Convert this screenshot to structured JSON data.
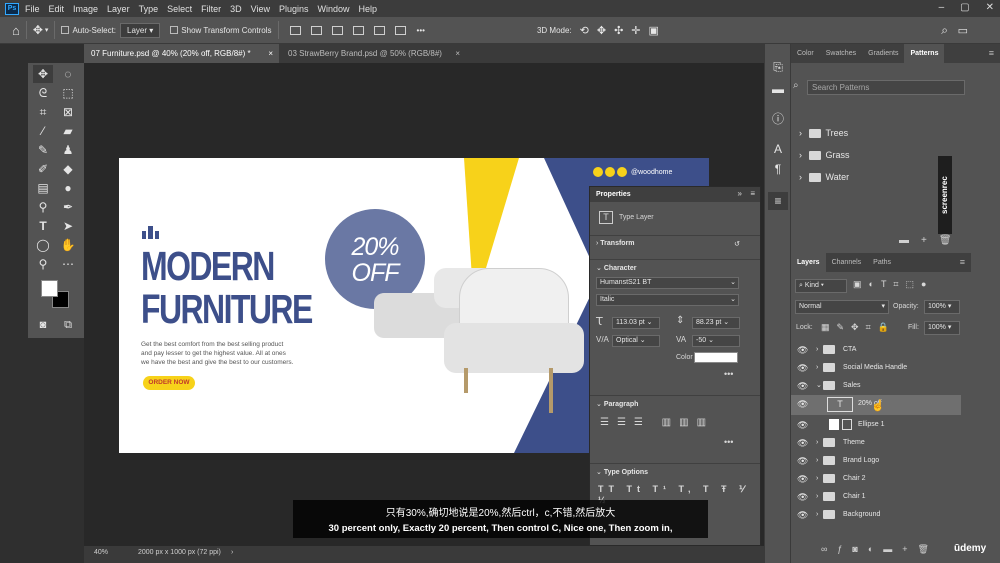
{
  "menu": {
    "items": [
      "File",
      "Edit",
      "Image",
      "Layer",
      "Type",
      "Select",
      "Filter",
      "3D",
      "View",
      "Plugins",
      "Window",
      "Help"
    ],
    "logo": "Ps",
    "window_controls": [
      "–",
      "▢",
      "✕"
    ]
  },
  "options": {
    "auto_select": "Auto-Select:",
    "layer_dropdown": "Layer",
    "show_transform": "Show Transform Controls",
    "mode_3d": "3D Mode:",
    "more": "•••"
  },
  "tabs": [
    {
      "label": "07 Furniture.psd @ 40% (20% off, RGB/8#) *",
      "close": "×",
      "active": true
    },
    {
      "label": "03 StrawBerry Brand.psd @ 50% (RGB/8#)",
      "close": "×",
      "active": false
    }
  ],
  "document": {
    "headline1": "MODERN",
    "headline2": "FURNITURE",
    "body": [
      "Get the best comfort from the best selling product",
      "and pay lesser to get the highest value. All at ones",
      "we have the best and give the best to our customers."
    ],
    "cta": "ORDER NOW",
    "badge_line1": "20%",
    "badge_line2": "OFF",
    "social_handle": "@woodhome",
    "colors": {
      "navy": "#3d4f8a",
      "yellow": "#f7d21a",
      "badge": "#6a78a4"
    }
  },
  "status": {
    "zoom": "40%",
    "doc_size": "2000 px x 1000 px (72 ppi)"
  },
  "properties": {
    "title": "Properties",
    "type_layer": "Type Layer",
    "transform": "Transform",
    "character": "Character",
    "font": "HumanstS21 BT",
    "style": "Italic",
    "size": "113.03 pt",
    "leading": "88.23 pt",
    "kerning": "Optical",
    "tracking": "-50",
    "color_label": "Color",
    "paragraph": "Paragraph",
    "type_options": "Type Options",
    "more": "•••"
  },
  "patterns_panel": {
    "tabs": [
      "Color",
      "Swatches",
      "Gradients",
      "Patterns"
    ],
    "search_placeholder": "Search Patterns",
    "groups": [
      "Trees",
      "Grass",
      "Water"
    ]
  },
  "layers_panel": {
    "tabs": [
      "Layers",
      "Channels",
      "Paths"
    ],
    "kind": "Kind",
    "blend": "Normal",
    "opacity_label": "Opacity:",
    "opacity": "100%",
    "lock_label": "Lock:",
    "fill_label": "Fill:",
    "fill": "100%",
    "layers": [
      {
        "name": "CTA",
        "type": "folder",
        "expanded": false
      },
      {
        "name": "Social Media Handle",
        "type": "folder",
        "expanded": false
      },
      {
        "name": "Sales",
        "type": "folder",
        "expanded": true
      },
      {
        "name": "20% off",
        "type": "text",
        "selected": true
      },
      {
        "name": "Ellipse 1",
        "type": "shape"
      },
      {
        "name": "Theme",
        "type": "folder",
        "expanded": false
      },
      {
        "name": "Brand Logo",
        "type": "folder",
        "expanded": false
      },
      {
        "name": "Chair 2",
        "type": "folder",
        "expanded": false
      },
      {
        "name": "Chair 1",
        "type": "folder",
        "expanded": false
      },
      {
        "name": "Background",
        "type": "folder",
        "expanded": false
      }
    ]
  },
  "watermark": {
    "screenrec": "screenrec",
    "udemy": "ūdemy"
  },
  "subtitle": {
    "zh": "只有30%,确切地说是20%,然后ctrl，c,不错,然后放大",
    "en": "30 percent only, Exactly 20 percent, Then control C, Nice one, Then zoom in,"
  }
}
